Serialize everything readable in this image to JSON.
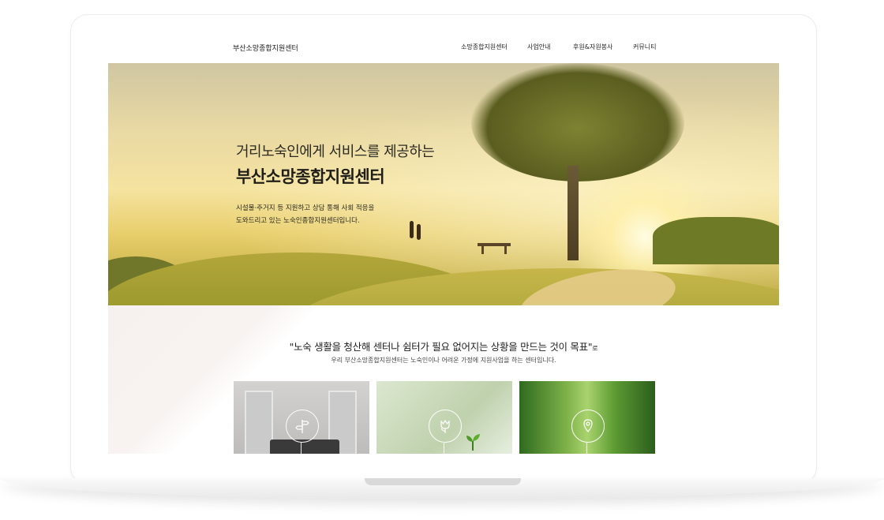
{
  "header": {
    "site_title": "부산소망종합지원센터",
    "nav": [
      "소망종합지원센터",
      "사업안내",
      "후원&자원봉사",
      "커뮤니티"
    ]
  },
  "hero": {
    "line1": "거리노숙인에게 서비스를 제공하는",
    "line2": "부산소망종합지원센터",
    "desc_line1": "시설물·주거지 등 지원하고 상담 통해 사회 적응을",
    "desc_line2": "도와드리고 있는 노숙인종합지원센터입니다."
  },
  "mission": {
    "quote": "\"노숙 생활을 청산해 센터나 쉼터가 필요 없어지는 상황을 만드는 것이 목표\"",
    "quote_suffix": "로",
    "sub": "우리 부산소망종합지원센터는 노숙인이나 어려운 가정에 지원사업을 하는 센터입니다."
  },
  "cards": [
    {
      "icon": "signpost-icon"
    },
    {
      "icon": "tulip-icon"
    },
    {
      "icon": "location-pin-icon"
    }
  ],
  "colors": {
    "text_dark": "#1e1d17",
    "hero_gold": "#e9cf6d",
    "forest_green": "#5d9b33"
  }
}
